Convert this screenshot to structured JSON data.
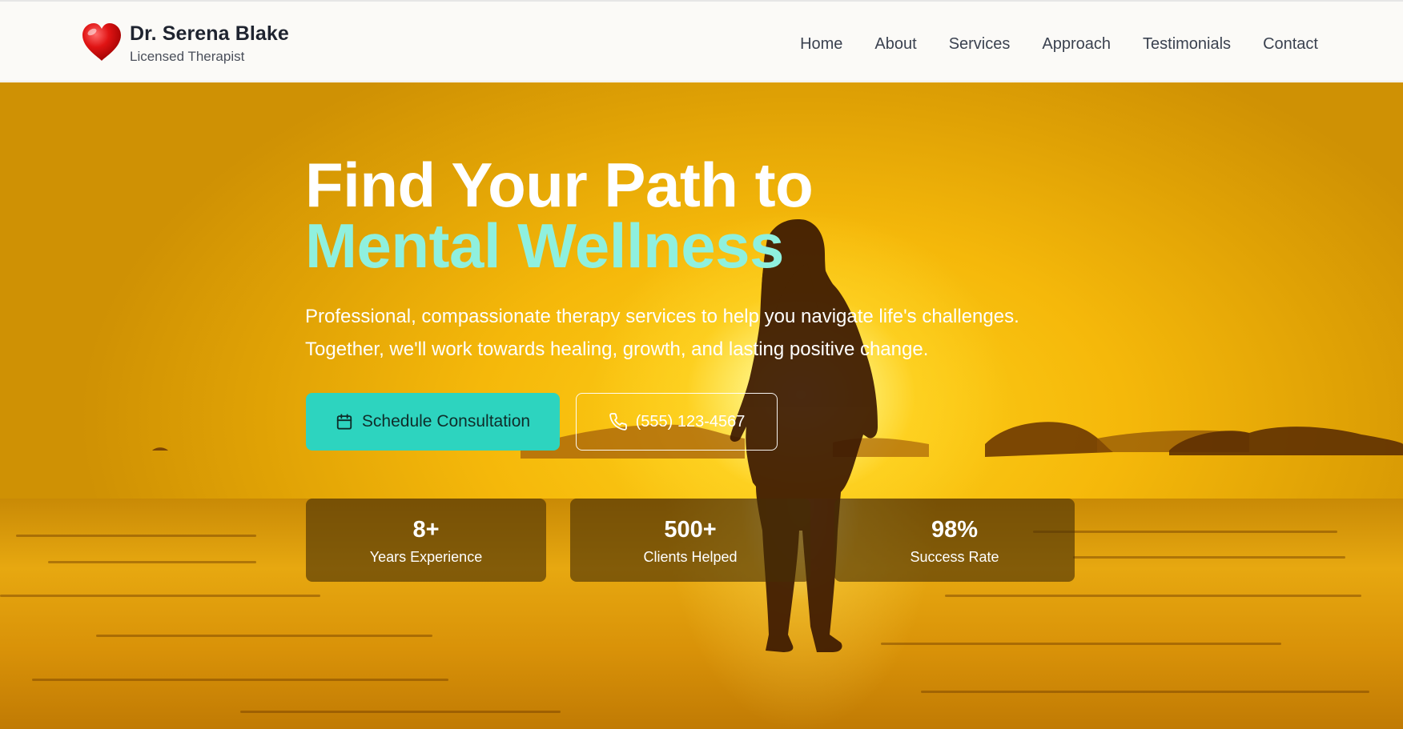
{
  "header": {
    "name": "Dr. Serena Blake",
    "subtitle": "Licensed Therapist",
    "logo_icon": "heart-icon",
    "nav": [
      {
        "label": "Home"
      },
      {
        "label": "About"
      },
      {
        "label": "Services"
      },
      {
        "label": "Approach"
      },
      {
        "label": "Testimonials"
      },
      {
        "label": "Contact"
      }
    ]
  },
  "hero": {
    "title_line1": "Find Your Path to",
    "title_line2": "Mental Wellness",
    "description": "Professional, compassionate therapy services to help you navigate life's challenges. Together, we'll work towards healing, growth, and lasting positive change.",
    "primary_button": {
      "label": "Schedule Consultation",
      "icon": "calendar-icon"
    },
    "phone_button": {
      "label": "(555) 123-4567",
      "icon": "phone-icon"
    },
    "stats": [
      {
        "value": "8+",
        "label": "Years Experience"
      },
      {
        "value": "500+",
        "label": "Clients Helped"
      },
      {
        "value": "98%",
        "label": "Success Rate"
      }
    ]
  },
  "colors": {
    "accent": "#2dd4bf",
    "title_highlight": "#8ff0de",
    "header_bg": "#fbfaf7",
    "stat_bg": "rgba(70,45,5,0.62)"
  }
}
